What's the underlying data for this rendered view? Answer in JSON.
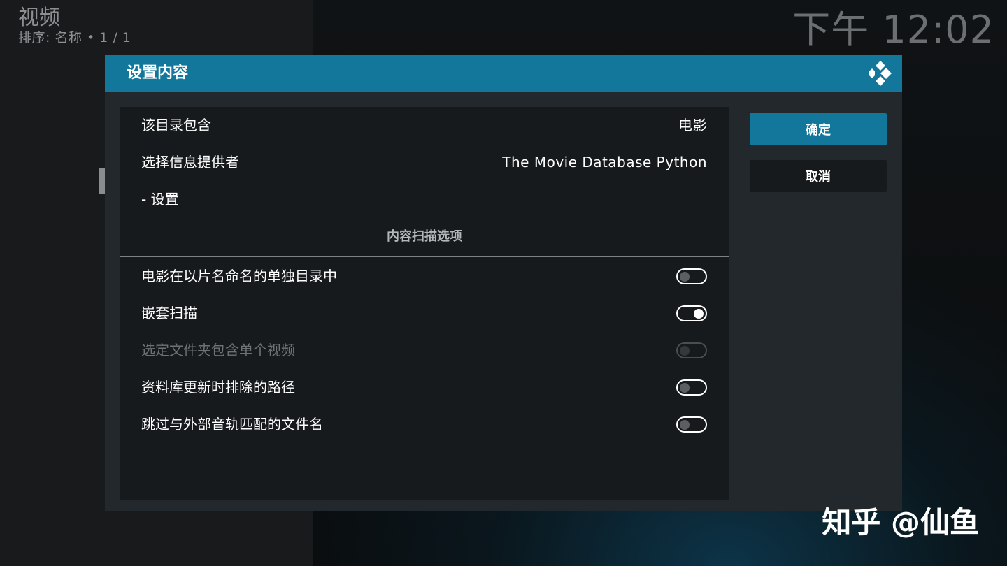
{
  "window": {
    "title": "视频",
    "subtitle": "排序: 名称  •  1 / 1",
    "clock": "下午 12:02"
  },
  "dialog": {
    "title": "设置内容",
    "logo_icon": "kodi-logo-icon",
    "rows": [
      {
        "label": "该目录包含",
        "value": "电影"
      },
      {
        "label": "选择信息提供者",
        "value": "The Movie Database Python"
      },
      {
        "label": "- 设置"
      }
    ],
    "section_title": "内容扫描选项",
    "toggles": [
      {
        "label": "电影在以片名命名的单独目录中",
        "on": false,
        "enabled": true
      },
      {
        "label": "嵌套扫描",
        "on": true,
        "enabled": true
      },
      {
        "label": "选定文件夹包含单个视频",
        "on": false,
        "enabled": false
      },
      {
        "label": "资料库更新时排除的路径",
        "on": false,
        "enabled": true
      },
      {
        "label": "跳过与外部音轨匹配的文件名",
        "on": false,
        "enabled": true
      }
    ],
    "ok_label": "确定",
    "cancel_label": "取消"
  },
  "watermark": "知乎 @仙鱼",
  "colors": {
    "accent": "#12779a",
    "dialog_bg": "#22282b",
    "panel_bg": "#171a1c"
  }
}
